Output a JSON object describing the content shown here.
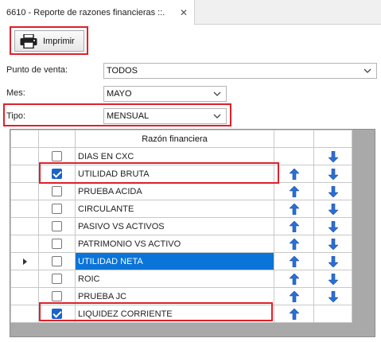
{
  "tab": {
    "title": "6610 - Reporte de razones financieras ::.",
    "close_glyph": "✕"
  },
  "toolbar": {
    "print_label": "Imprimir"
  },
  "filters": {
    "punto_venta": {
      "label": "Punto de venta:",
      "value": "TODOS"
    },
    "mes": {
      "label": "Mes:",
      "value": "MAYO"
    },
    "tipo": {
      "label": "Tipo:",
      "value": "MENSUAL"
    }
  },
  "grid": {
    "header": "Razón financiera",
    "rows": [
      {
        "name": "DIAS EN CXC",
        "checked": false,
        "up": false,
        "down": true,
        "selected": false,
        "current": false
      },
      {
        "name": "UTILIDAD BRUTA",
        "checked": true,
        "up": true,
        "down": true,
        "selected": false,
        "current": false
      },
      {
        "name": "PRUEBA ACIDA",
        "checked": false,
        "up": true,
        "down": true,
        "selected": false,
        "current": false
      },
      {
        "name": "CIRCULANTE",
        "checked": false,
        "up": true,
        "down": true,
        "selected": false,
        "current": false
      },
      {
        "name": "PASIVO VS ACTIVOS",
        "checked": false,
        "up": true,
        "down": true,
        "selected": false,
        "current": false
      },
      {
        "name": "PATRIMONIO VS ACTIVO",
        "checked": false,
        "up": true,
        "down": true,
        "selected": false,
        "current": false
      },
      {
        "name": "UTILIDAD NETA",
        "checked": false,
        "up": true,
        "down": true,
        "selected": true,
        "current": true
      },
      {
        "name": "ROIC",
        "checked": false,
        "up": true,
        "down": true,
        "selected": false,
        "current": false
      },
      {
        "name": "PRUEBA JC",
        "checked": false,
        "up": true,
        "down": true,
        "selected": false,
        "current": false
      },
      {
        "name": "LIQUIDEZ CORRIENTE",
        "checked": true,
        "up": true,
        "down": false,
        "selected": false,
        "current": false
      }
    ]
  },
  "colors": {
    "highlight": "#e0202a",
    "selection": "#0a74d8",
    "arrow": "#2a6fd6",
    "grid_bg": "#a9a9a9"
  },
  "icons": {
    "print": "printer-icon",
    "up": "arrow-up-icon",
    "down": "arrow-down-icon",
    "dropdown": "chevron-down-icon"
  }
}
